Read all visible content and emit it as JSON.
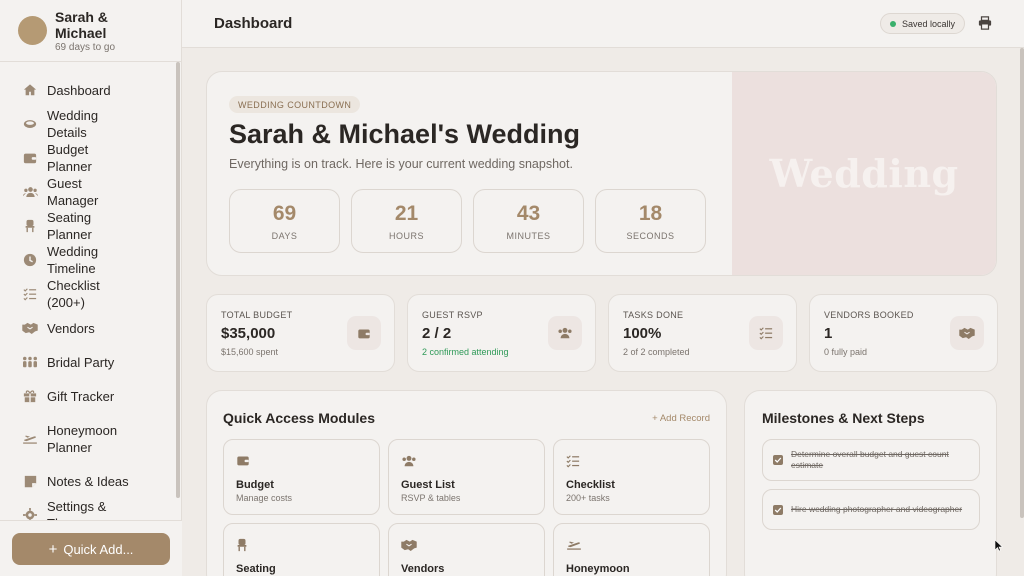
{
  "profile": {
    "name": "Sarah & Michael",
    "days_to_go": "69 days to go"
  },
  "sidebar": {
    "items": [
      {
        "label": "Dashboard",
        "icon": "home-icon"
      },
      {
        "label": "Wedding Details",
        "icon": "rings-icon"
      },
      {
        "label": "Budget Planner",
        "icon": "wallet-icon"
      },
      {
        "label": "Guest Manager",
        "icon": "users-icon"
      },
      {
        "label": "Seating Planner",
        "icon": "chair-icon"
      },
      {
        "label": "Wedding Timeline",
        "icon": "clock-icon"
      },
      {
        "label": "Checklist (200+)",
        "icon": "checklist-icon"
      },
      {
        "label": "Vendors",
        "icon": "handshake-icon"
      },
      {
        "label": "Bridal Party",
        "icon": "people-icon"
      },
      {
        "label": "Gift Tracker",
        "icon": "gift-icon"
      },
      {
        "label": "Honeymoon Planner",
        "icon": "plane-icon"
      },
      {
        "label": "Notes & Ideas",
        "icon": "note-icon"
      },
      {
        "label": "Settings & Themes",
        "icon": "gear-icon"
      }
    ],
    "quick_add_label": "Quick Add..."
  },
  "header": {
    "title": "Dashboard",
    "saved_status": "Saved locally"
  },
  "hero": {
    "pill": "WEDDING COUNTDOWN",
    "title": "Sarah & Michael's Wedding",
    "subtitle": "Everything is on track. Here is your current wedding snapshot.",
    "watermark": "Wedding",
    "countdown": [
      {
        "value": "69",
        "label": "DAYS"
      },
      {
        "value": "21",
        "label": "HOURS"
      },
      {
        "value": "43",
        "label": "MINUTES"
      },
      {
        "value": "18",
        "label": "SECONDS"
      }
    ]
  },
  "stats": [
    {
      "label": "TOTAL BUDGET",
      "value": "$35,000",
      "sub": "$15,600 spent",
      "icon": "wallet-icon"
    },
    {
      "label": "GUEST RSVP",
      "value": "2 / 2",
      "sub": "2 confirmed attending",
      "icon": "users-icon"
    },
    {
      "label": "TASKS DONE",
      "value": "100%",
      "sub": "2 of 2 completed",
      "icon": "checklist-icon"
    },
    {
      "label": "VENDORS BOOKED",
      "value": "1",
      "sub": "0 fully paid",
      "icon": "handshake-icon"
    }
  ],
  "quick_access": {
    "title": "Quick Access Modules",
    "add_label": "+ Add Record",
    "tiles": [
      {
        "title": "Budget",
        "sub": "Manage costs",
        "icon": "wallet-icon"
      },
      {
        "title": "Guest List",
        "sub": "RSVP & tables",
        "icon": "users-icon"
      },
      {
        "title": "Checklist",
        "sub": "200+ tasks",
        "icon": "checklist-icon"
      },
      {
        "title": "Seating",
        "sub": "",
        "icon": "chair-icon"
      },
      {
        "title": "Vendors",
        "sub": "",
        "icon": "handshake-icon"
      },
      {
        "title": "Honeymoon",
        "sub": "",
        "icon": "plane-icon"
      }
    ]
  },
  "milestones": {
    "title": "Milestones & Next Steps",
    "items": [
      {
        "text": "Determine overall budget and guest count estimate",
        "done": true
      },
      {
        "text": "Hire wedding photographer and videographer",
        "done": true
      }
    ]
  },
  "colors": {
    "accent": "#a4896a",
    "success": "#3ab06c",
    "hero_panel": "#ece0de"
  }
}
